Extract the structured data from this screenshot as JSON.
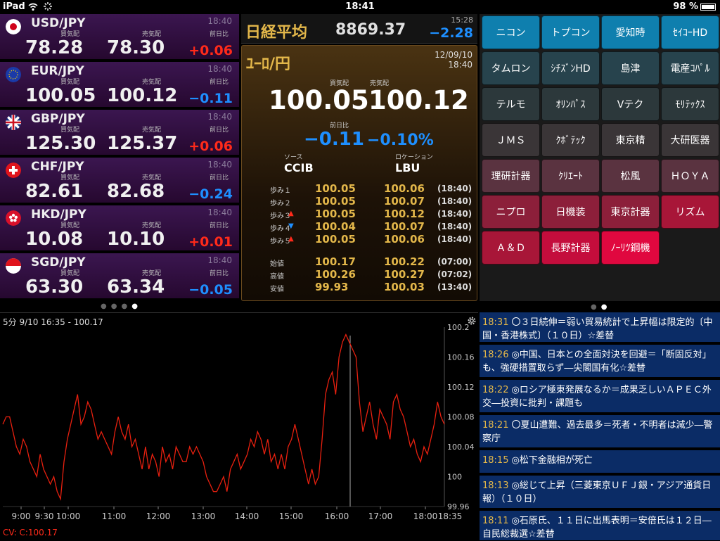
{
  "status": {
    "device": "iPad",
    "time": "18:41",
    "battery": "98 %"
  },
  "fx": {
    "bid_label": "買気配",
    "ask_label": "売気配",
    "chg_label": "前日比",
    "rows": [
      {
        "pair": "USD/JPY",
        "time": "18:40",
        "bid": "78.28",
        "ask": "78.30",
        "chg": "+0.06",
        "dir": "up",
        "flag": "jp"
      },
      {
        "pair": "EUR/JPY",
        "time": "18:40",
        "bid": "100.05",
        "ask": "100.12",
        "chg": "−0.11",
        "dir": "down",
        "flag": "eu"
      },
      {
        "pair": "GBP/JPY",
        "time": "18:40",
        "bid": "125.30",
        "ask": "125.37",
        "chg": "+0.06",
        "dir": "up",
        "flag": "uk"
      },
      {
        "pair": "CHF/JPY",
        "time": "18:40",
        "bid": "82.61",
        "ask": "82.68",
        "chg": "−0.24",
        "dir": "down",
        "flag": "ch"
      },
      {
        "pair": "HKD/JPY",
        "time": "18:40",
        "bid": "10.08",
        "ask": "10.10",
        "chg": "+0.01",
        "dir": "up",
        "flag": "hk"
      },
      {
        "pair": "SGD/JPY",
        "time": "18:40",
        "bid": "63.30",
        "ask": "63.34",
        "chg": "−0.05",
        "dir": "down",
        "flag": "sg"
      }
    ]
  },
  "nikkei": {
    "name": "日経平均",
    "value": "8869.37",
    "time": "15:28",
    "change": "−2.28"
  },
  "detail": {
    "title": "ﾕｰﾛ/円",
    "date": "12/09/10",
    "time": "18:40",
    "bid_label": "買気配",
    "ask_label": "売気配",
    "bid": "100.05",
    "ask": "100.12",
    "chg_label": "前日比",
    "chg": "−0.11",
    "chg_pct": "−0.10%",
    "source_label": "ソース",
    "source": "CCIB",
    "location_label": "ロケーション",
    "location": "LBU",
    "steps": [
      {
        "k": "歩み１",
        "arrow": "",
        "v1": "100.05",
        "v2": "100.06",
        "t": "(18:40)"
      },
      {
        "k": "歩み２",
        "arrow": "",
        "v1": "100.05",
        "v2": "100.07",
        "t": "(18:40)"
      },
      {
        "k": "歩み３",
        "arrow": "▲",
        "v1": "100.05",
        "v2": "100.12",
        "t": "(18:40)"
      },
      {
        "k": "歩み４",
        "arrow": "▼",
        "v1": "100.04",
        "v2": "100.07",
        "t": "(18:40)"
      },
      {
        "k": "歩み５",
        "arrow": "▲",
        "v1": "100.05",
        "v2": "100.06",
        "t": "(18:40)"
      }
    ],
    "ohlc": [
      {
        "k": "始値",
        "v1": "100.17",
        "v2": "100.22",
        "t": "(07:00)"
      },
      {
        "k": "高値",
        "v1": "100.26",
        "v2": "100.27",
        "t": "(07:02)"
      },
      {
        "k": "安値",
        "v1": "99.93",
        "v2": "100.03",
        "t": "(13:40)"
      }
    ]
  },
  "stocks": [
    {
      "label": "ニコン",
      "color": "#0f7fae"
    },
    {
      "label": "トプコン",
      "color": "#0f7fae"
    },
    {
      "label": "愛知時",
      "color": "#0f7fae"
    },
    {
      "label": "ｾｲｺｰHD",
      "color": "#0f7fae"
    },
    {
      "label": "タムロン",
      "color": "#27434d"
    },
    {
      "label": "ｼﾁｽﾞﾝHD",
      "color": "#27434d"
    },
    {
      "label": "島津",
      "color": "#27434d"
    },
    {
      "label": "電産ｺﾊﾟﾙ",
      "color": "#27434d"
    },
    {
      "label": "テルモ",
      "color": "#2c383b"
    },
    {
      "label": "ｵﾘﾝﾊﾟｽ",
      "color": "#2c383b"
    },
    {
      "label": "Vテク",
      "color": "#2c383b"
    },
    {
      "label": "ﾓﾘﾃｯｸｽ",
      "color": "#2c383b"
    },
    {
      "label": "ＪＭＳ",
      "color": "#3a3537"
    },
    {
      "label": "ｸﾎﾞﾃｯｸ",
      "color": "#3a3537"
    },
    {
      "label": "東京精",
      "color": "#3a3537"
    },
    {
      "label": "大研医器",
      "color": "#3a3537"
    },
    {
      "label": "理研計器",
      "color": "#5a3340"
    },
    {
      "label": "ｸﾘｴｰﾄ",
      "color": "#5a3340"
    },
    {
      "label": "松風",
      "color": "#5a3340"
    },
    {
      "label": "ＨＯＹＡ",
      "color": "#5a3340"
    },
    {
      "label": "ニプロ",
      "color": "#8c1f3a"
    },
    {
      "label": "日機装",
      "color": "#8c1f3a"
    },
    {
      "label": "東京計器",
      "color": "#8c1f3a"
    },
    {
      "label": "リズム",
      "color": "#a81638"
    },
    {
      "label": "Ａ＆Ｄ",
      "color": "#a81638"
    },
    {
      "label": "長野計器",
      "color": "#c40d3c"
    },
    {
      "label": "ﾉｰﾘﾂ鋼機",
      "color": "#e0083f"
    }
  ],
  "chart": {
    "header": "5分 9/10 16:35 - 100.17",
    "cv": "CV: C:100.17",
    "chart_data": {
      "type": "line",
      "xlabel": "",
      "ylabel": "",
      "ylim": [
        99.96,
        100.2
      ],
      "x_ticks": [
        "9:00",
        "9:30",
        "10:00",
        "11:00",
        "12:00",
        "13:00",
        "14:00",
        "15:00",
        "16:00",
        "17:00",
        "18:00",
        "18:35"
      ],
      "y_ticks": [
        "100.2",
        "100.16",
        "100.12",
        "100.08",
        "100.04",
        "100",
        "99.96"
      ],
      "series": [
        {
          "values": [
            100.07,
            100.08,
            100.08,
            100.06,
            100.04,
            100.03,
            100.05,
            100.04,
            100.02,
            100.01,
            100,
            100.03,
            100.01,
            100,
            99.99,
            100,
            99.98,
            99.97,
            100.02,
            100.05,
            100.07,
            100.09,
            100.11,
            100.07,
            100.08,
            100.1,
            100.09,
            100.07,
            100.05,
            100.06,
            100.05,
            100.04,
            100.03,
            100.06,
            100.08,
            100.06,
            100.05,
            100.07,
            100.04,
            100.05,
            100.03,
            100.01,
            100.04,
            100.01,
            100.03,
            100.02,
            100,
            100.04,
            100.02,
            100.03,
            100.01,
            100.04,
            100.03,
            100.02,
            100.02,
            100.04,
            100.03,
            100.04,
            100.03,
            100.02,
            100,
            99.99,
            99.98,
            99.98,
            99.99,
            100,
            99.98,
            100.01,
            100.02,
            100.03,
            100.01,
            100.02,
            100.03,
            100.05,
            100.04,
            100.06,
            100.05,
            100.03,
            100.05,
            100.02,
            100.03,
            100.01,
            100.03,
            100.01,
            100.04,
            100.05,
            100.07,
            100.05,
            100.03,
            100.01,
            99.99,
            100.01,
            99.99,
            100,
            100.05,
            100.11,
            100.13,
            100.14,
            100.11,
            100.16,
            100.18,
            100.19,
            100.18,
            100.17,
            100.16,
            100.1,
            100.06,
            100.08,
            100.1,
            100.07,
            100.05,
            100.09,
            100.08,
            100.07,
            100.05,
            100.1,
            100.11,
            100.09,
            100.08,
            100.06,
            100.04,
            100.05,
            100.03,
            100.02,
            100.04,
            100.03,
            100.05,
            100.07,
            100.1,
            100.08,
            100.07
          ]
        }
      ]
    }
  },
  "news": [
    {
      "time": "18:31",
      "text": "〇３日続伸＝弱い貿易統計で上昇幅は限定的〔中国・香港株式〕（１０日）☆差替"
    },
    {
      "time": "18:26",
      "text": "◎中国、日本との全面対決を回避＝「断固反対」も、強硬措置取らず―尖閣国有化☆差替"
    },
    {
      "time": "18:22",
      "text": "◎ロシア極東発展なるか＝成果乏しいＡＰＥＣ外交―投資に批判・課題も"
    },
    {
      "time": "18:21",
      "text": "〇夏山遭難、過去最多＝死者・不明者は減少―警察庁"
    },
    {
      "time": "18:15",
      "text": "◎松下金融相が死亡"
    },
    {
      "time": "18:13",
      "text": "◎総じて上昇（三菱東京ＵＦＪ銀・アジア通貨日報）（１０日）"
    },
    {
      "time": "18:11",
      "text": "◎石原氏、１１日に出馬表明＝安倍氏は１２日―自民総裁選☆差替"
    }
  ]
}
